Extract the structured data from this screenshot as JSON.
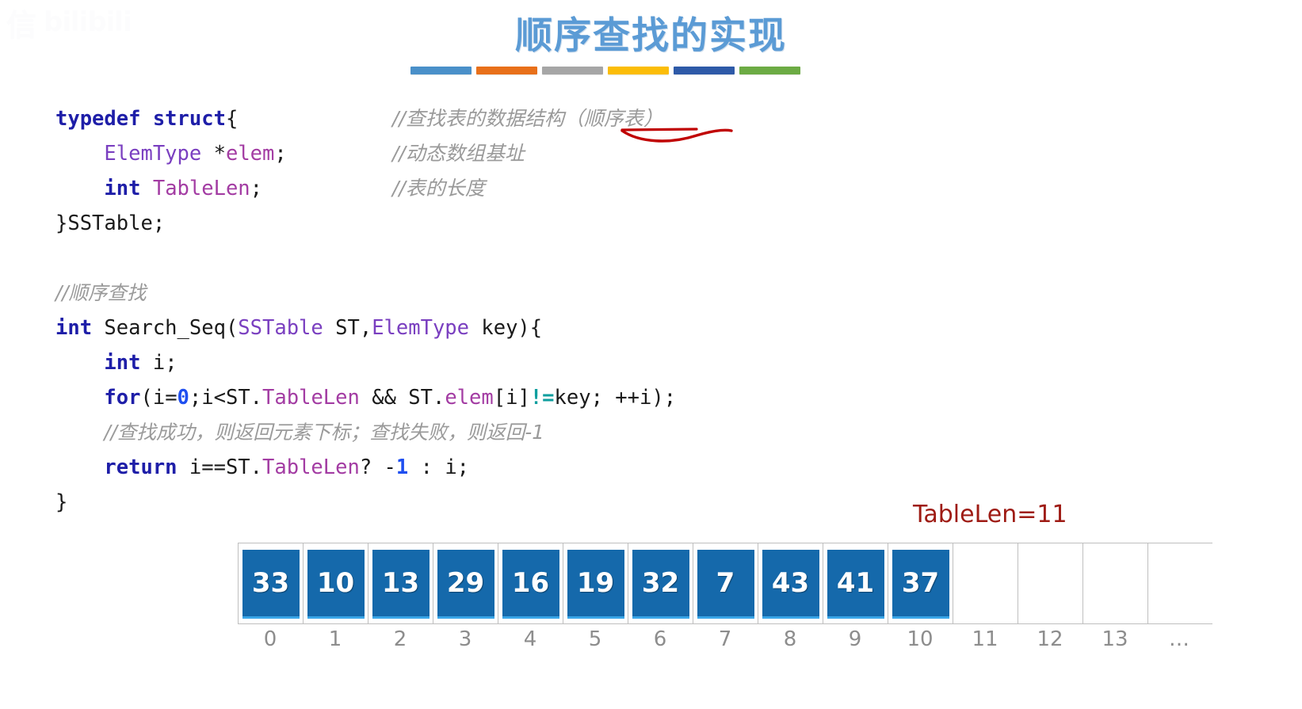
{
  "slide": {
    "title": "顺序查找的实现",
    "title_color": "#5b9bd5",
    "background": "#ffffff"
  },
  "watermark": {
    "text": "信",
    "logo": "bilibili",
    "color": "#fafbfc"
  },
  "decorative_bars": {
    "colors": [
      "#4a90c9",
      "#e8701a",
      "#a6a6a6",
      "#fbbd08",
      "#2e5aa8",
      "#6cab44"
    ]
  },
  "code": {
    "language": "C",
    "lines": [
      {
        "id": "line-typedef",
        "indent": 0,
        "tokens": [
          {
            "t": "typedef",
            "c": "kw"
          },
          {
            "t": " ",
            "c": "plain"
          },
          {
            "t": "struct",
            "c": "kw"
          },
          {
            "t": "{",
            "c": "plain"
          }
        ],
        "comment": "//查找表的数据结构（顺序表）"
      },
      {
        "id": "line-elem",
        "indent": 1,
        "tokens": [
          {
            "t": "ElemType",
            "c": "typ2"
          },
          {
            "t": " ",
            "c": "plain"
          },
          {
            "t": "*",
            "c": "plain"
          },
          {
            "t": "elem",
            "c": "typ"
          },
          {
            "t": ";",
            "c": "plain"
          }
        ],
        "comment": "//动态数组基址"
      },
      {
        "id": "line-tablelen",
        "indent": 1,
        "tokens": [
          {
            "t": "int",
            "c": "kw"
          },
          {
            "t": " ",
            "c": "plain"
          },
          {
            "t": "TableLen",
            "c": "typ"
          },
          {
            "t": ";",
            "c": "plain"
          }
        ],
        "comment": "//表的长度"
      },
      {
        "id": "line-close-struct",
        "indent": 0,
        "tokens": [
          {
            "t": "}SSTable;",
            "c": "plain"
          }
        ],
        "comment": ""
      },
      {
        "id": "line-blank-1",
        "indent": 0,
        "tokens": [],
        "comment": ""
      },
      {
        "id": "line-comment-seqsearch",
        "indent": 0,
        "tokens": [
          {
            "t": "//顺序查找",
            "c": "cmt"
          }
        ],
        "comment": ""
      },
      {
        "id": "line-func-signature",
        "indent": 0,
        "tokens": [
          {
            "t": "int",
            "c": "kw"
          },
          {
            "t": " Search_Seq(",
            "c": "plain"
          },
          {
            "t": "SSTable",
            "c": "typ2"
          },
          {
            "t": " ST,",
            "c": "plain"
          },
          {
            "t": "ElemType",
            "c": "typ2"
          },
          {
            "t": " key){",
            "c": "plain"
          }
        ],
        "comment": ""
      },
      {
        "id": "line-decl-i",
        "indent": 1,
        "tokens": [
          {
            "t": "int",
            "c": "kw"
          },
          {
            "t": " i;",
            "c": "plain"
          }
        ],
        "comment": ""
      },
      {
        "id": "line-for-loop",
        "indent": 1,
        "tokens": [
          {
            "t": "for",
            "c": "kw"
          },
          {
            "t": "(i=",
            "c": "plain"
          },
          {
            "t": "0",
            "c": "num"
          },
          {
            "t": ";i<ST.",
            "c": "plain"
          },
          {
            "t": "TableLen",
            "c": "typ"
          },
          {
            "t": " && ST.",
            "c": "plain"
          },
          {
            "t": "elem",
            "c": "typ"
          },
          {
            "t": "[i]",
            "c": "plain"
          },
          {
            "t": "!=",
            "c": "op"
          },
          {
            "t": "key; ++i);",
            "c": "plain"
          }
        ],
        "comment": ""
      },
      {
        "id": "line-comment-result",
        "indent": 1,
        "tokens": [
          {
            "t": "//查找成功，则返回元素下标；查找失败，则返回-1",
            "c": "cmt"
          }
        ],
        "comment": ""
      },
      {
        "id": "line-return",
        "indent": 1,
        "tokens": [
          {
            "t": "return",
            "c": "kw"
          },
          {
            "t": " i==ST.",
            "c": "plain"
          },
          {
            "t": "TableLen",
            "c": "typ"
          },
          {
            "t": "? -",
            "c": "plain"
          },
          {
            "t": "1",
            "c": "num"
          },
          {
            "t": " : i;",
            "c": "plain"
          }
        ],
        "comment": ""
      },
      {
        "id": "line-close-func",
        "indent": 0,
        "tokens": [
          {
            "t": "}",
            "c": "plain"
          }
        ],
        "comment": ""
      }
    ]
  },
  "annotation": {
    "tablelen_note": "TableLen=11",
    "tablelen_note_color": "#9e1b14",
    "red_underline_color": "#c00000"
  },
  "array_visual": {
    "values": [
      "33",
      "10",
      "13",
      "29",
      "16",
      "19",
      "32",
      "7",
      "43",
      "41",
      "37"
    ],
    "empty_cells": 3,
    "indices": [
      "0",
      "1",
      "2",
      "3",
      "4",
      "5",
      "6",
      "7",
      "8",
      "9",
      "10",
      "11",
      "12",
      "13"
    ],
    "trailing_ellipsis": "…",
    "chip_color": "#1569ab",
    "chip_text_color": "#ffffff",
    "index_color": "#8d8d8d",
    "border_color": "#bfbfbf"
  }
}
